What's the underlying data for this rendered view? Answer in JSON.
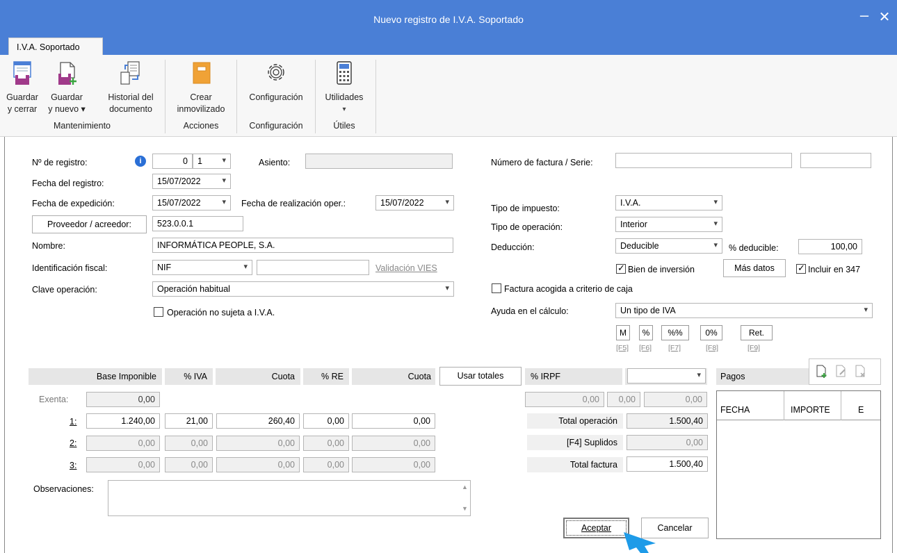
{
  "window": {
    "title": "Nuevo registro de I.V.A. Soportado"
  },
  "ribbon": {
    "tab": "I.V.A. Soportado",
    "buttons": {
      "guardar_cerrar": [
        "Guardar",
        "y cerrar"
      ],
      "guardar_nuevo": [
        "Guardar",
        "y nuevo ▾"
      ],
      "historial": [
        "Historial del",
        "documento"
      ],
      "crear": [
        "Crear",
        "inmovilizado"
      ],
      "configuracion": "Configuración",
      "utilidades": "Utilidades"
    },
    "groups": {
      "mantenimiento": "Mantenimiento",
      "acciones": "Acciones",
      "configuracion": "Configuración",
      "utiles": "Útiles"
    }
  },
  "form": {
    "labels": {
      "num_registro": "Nº de registro:",
      "fecha_registro": "Fecha del registro:",
      "fecha_expedicion": "Fecha de expedición:",
      "fecha_realizacion": "Fecha de realización oper.:",
      "asiento": "Asiento:",
      "proveedor_btn": "Proveedor / acreedor:",
      "nombre": "Nombre:",
      "ident_fiscal": "Identificación fiscal:",
      "clave_operacion": "Clave operación:",
      "no_sujeta": "Operación no sujeta a I.V.A.",
      "numero_factura": "Número de factura / Serie:",
      "tipo_impuesto": "Tipo de impuesto:",
      "tipo_operacion": "Tipo de operación:",
      "deduccion": "Deducción:",
      "pct_deducible": "% deducible:",
      "bien_inversion": "Bien de inversión",
      "mas_datos": "Más datos",
      "incluir_347": "Incluir en 347",
      "criterio_caja": "Factura acogida a criterio de caja",
      "ayuda_calculo": "Ayuda en el cálculo:",
      "validacion_vies": "Validación VIES"
    },
    "values": {
      "num_registro": "0",
      "num_registro_serie": "1",
      "fecha_registro": "15/07/2022",
      "fecha_expedicion": "15/07/2022",
      "fecha_realizacion": "15/07/2022",
      "asiento": "",
      "proveedor": "523.0.0.1",
      "nombre": "INFORMÁTICA PEOPLE, S.A.",
      "ident_tipo": "NIF",
      "ident_numero": "",
      "clave_operacion": "Operación habitual",
      "numero_factura": "",
      "serie": "",
      "tipo_impuesto": "I.V.A.",
      "tipo_operacion": "Interior",
      "deduccion": "Deducible",
      "pct_deducible": "100,00",
      "ayuda_calculo": "Un tipo de IVA"
    },
    "checks": {
      "no_sujeta": false,
      "bien_inversion": true,
      "incluir_347": true,
      "criterio_caja": false
    },
    "calc_buttons": [
      {
        "label": "M",
        "key": "[F5]"
      },
      {
        "label": "%",
        "key": "[F6]"
      },
      {
        "label": "%%",
        "key": "[F7]"
      },
      {
        "label": "0%",
        "key": "[F8]"
      },
      {
        "label": "Ret.",
        "key": "[F9]"
      }
    ]
  },
  "grid": {
    "headers": {
      "base": "Base Imponible",
      "pct_iva": "% IVA",
      "cuota": "Cuota",
      "pct_re": "% RE",
      "cuota_re": "Cuota",
      "usar_totales": "Usar totales",
      "pct_irpf": "% IRPF"
    },
    "exenta": {
      "label": "Exenta:",
      "base": "0,00"
    },
    "rows": [
      {
        "label": "1:",
        "base": "1.240,00",
        "pct_iva": "21,00",
        "cuota": "260,40",
        "pct_re": "0,00",
        "cuota_re": "0,00"
      },
      {
        "label": "2:",
        "base": "0,00",
        "pct_iva": "0,00",
        "cuota": "0,00",
        "pct_re": "0,00",
        "cuota_re": "0,00"
      },
      {
        "label": "3:",
        "base": "0,00",
        "pct_iva": "0,00",
        "cuota": "0,00",
        "pct_re": "0,00",
        "cuota_re": "0,00"
      }
    ],
    "irpf": {
      "base": "0,00",
      "pct": "0,00",
      "cuota": "0,00"
    },
    "totals": {
      "total_operacion_label": "Total operación",
      "total_operacion": "1.500,40",
      "suplidos_label": "[F4] Suplidos",
      "suplidos": "0,00",
      "total_factura_label": "Total factura",
      "total_factura": "1.500,40"
    },
    "observaciones_label": "Observaciones:",
    "observaciones": ""
  },
  "pagos": {
    "title": "Pagos",
    "columns": [
      "FECHA",
      "IMPORTE",
      "E"
    ]
  },
  "footer": {
    "aceptar": "Aceptar",
    "cancelar": "Cancelar"
  }
}
